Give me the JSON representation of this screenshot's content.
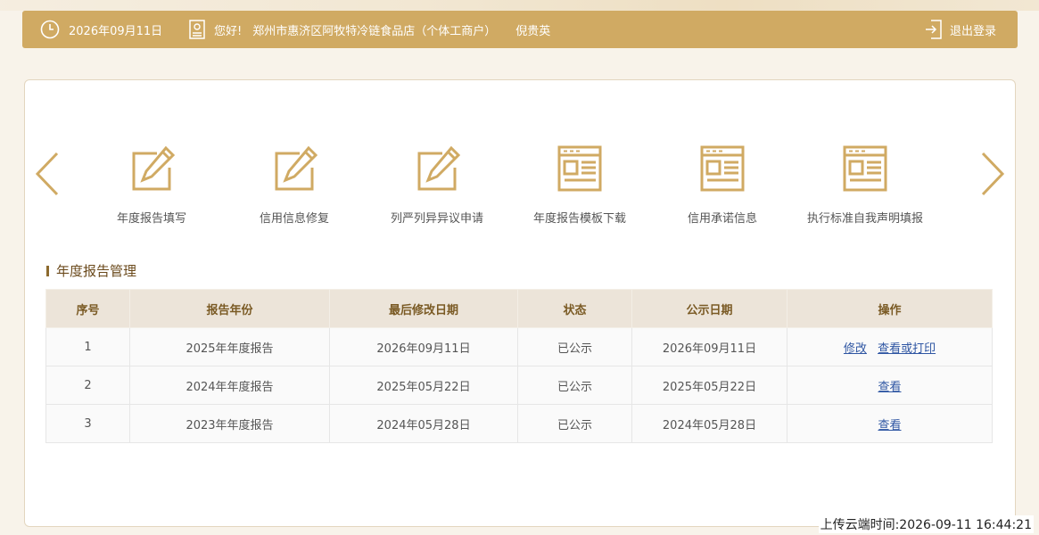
{
  "header": {
    "date": "2026年09月11日",
    "greeting": "您好!",
    "shop_name": "郑州市惠济区阿牧特冷链食品店（个体工商户）",
    "user_name": "倪贵英",
    "logout_label": "退出登录"
  },
  "functions": [
    {
      "label": "年度报告填写",
      "icon": "edit-icon"
    },
    {
      "label": "信用信息修复",
      "icon": "edit-icon"
    },
    {
      "label": "列严列异异议申请",
      "icon": "edit-icon"
    },
    {
      "label": "年度报告模板下载",
      "icon": "document-icon"
    },
    {
      "label": "信用承诺信息",
      "icon": "document-icon"
    },
    {
      "label": "执行标准自我声明填报",
      "icon": "document-icon"
    }
  ],
  "section_title": "年度报告管理",
  "table": {
    "headers": [
      "序号",
      "报告年份",
      "最后修改日期",
      "状态",
      "公示日期",
      "操作"
    ],
    "rows": [
      {
        "no": "1",
        "year": "2025年年度报告",
        "modified": "2026年09月11日",
        "status": "已公示",
        "published": "2026年09月11日",
        "actions": [
          "修改",
          "查看或打印"
        ]
      },
      {
        "no": "2",
        "year": "2024年年度报告",
        "modified": "2025年05月22日",
        "status": "已公示",
        "published": "2025年05月22日",
        "actions": [
          "查看"
        ]
      },
      {
        "no": "3",
        "year": "2023年年度报告",
        "modified": "2024年05月28日",
        "status": "已公示",
        "published": "2024年05月28日",
        "actions": [
          "查看"
        ]
      }
    ]
  },
  "upload_time": "上传云端时间:2026-09-11 16:44:21",
  "colors": {
    "accent": "#d0aa63",
    "link": "#2f56a3",
    "table_header_bg": "#ece4d9"
  }
}
